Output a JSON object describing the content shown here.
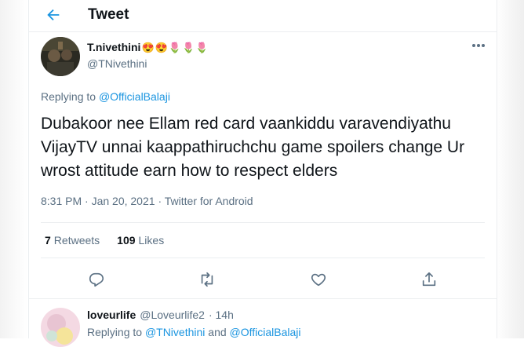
{
  "header": {
    "title": "Tweet"
  },
  "tweet": {
    "display_name": "T.nivethini",
    "name_emojis": [
      "😍",
      "😍",
      "🌷",
      "🌷",
      "🌷"
    ],
    "handle": "@TNivethini",
    "replying_label": "Replying to",
    "replying_to": "@OfficialBalaji",
    "text": "Dubakoor nee Ellam red card vaankiddu varavendiyathu VijayTV unnai kaappathiruchchu game spoilers change Ur wrost attitude earn how to respect elders",
    "timestamp": "8:31 PM · Jan 20, 2021",
    "source_prefix": "·",
    "source": "Twitter for Android",
    "retweets_count": "7",
    "retweets_label": "Retweets",
    "likes_count": "109",
    "likes_label": "Likes"
  },
  "reply": {
    "display_name": "loveurlife",
    "handle": "@Loveurlife2",
    "time": "· 14h",
    "replying_label": "Replying to",
    "replying_to_1": "@TNivethini",
    "and_label": "and",
    "replying_to_2": "@OfficialBalaji"
  },
  "colors": {
    "accent": "#1b95e0",
    "secondary_text": "#5b7083",
    "primary_text": "#0f1419",
    "border": "#ebeef0"
  },
  "icons": [
    "back-arrow-icon",
    "more-icon",
    "reply-icon",
    "retweet-icon",
    "like-icon",
    "share-icon"
  ]
}
